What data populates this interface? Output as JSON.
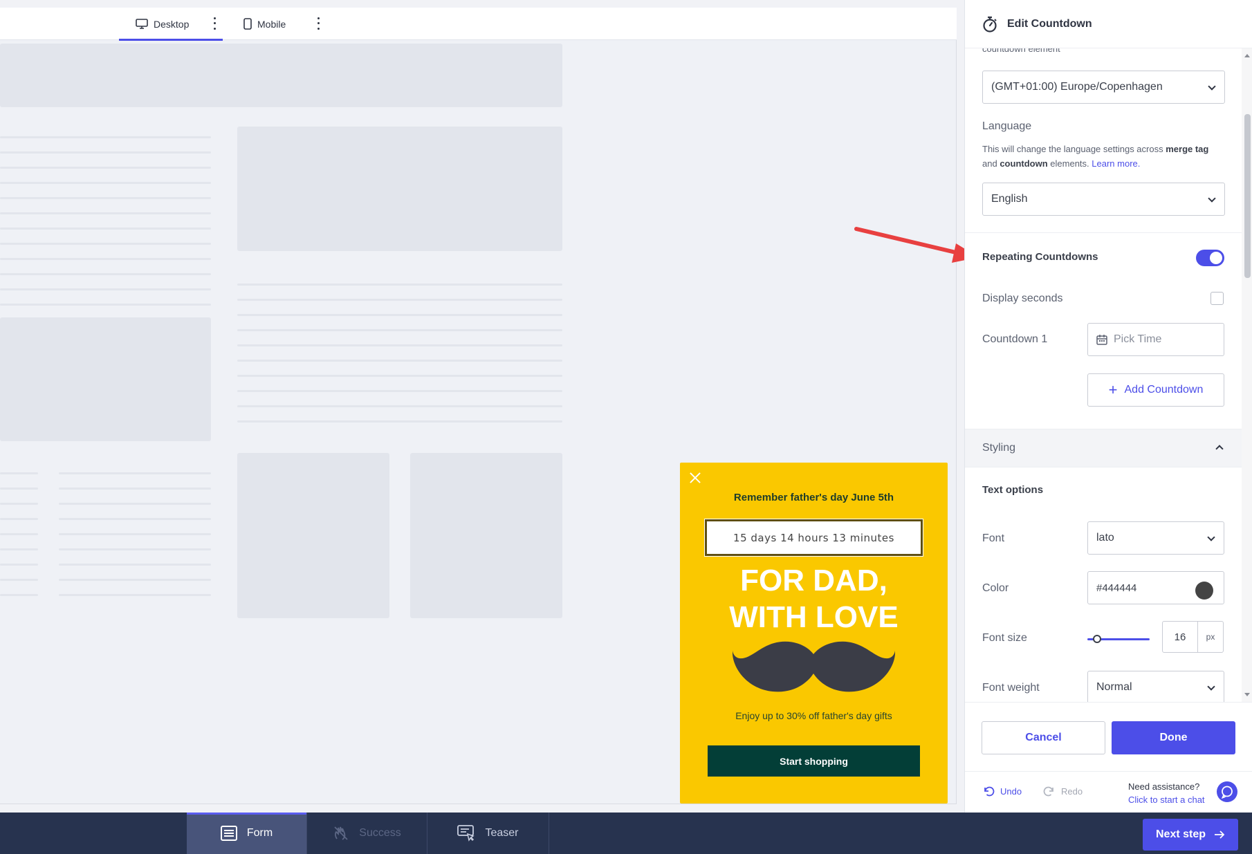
{
  "device_bar": {
    "desktop_label": "Desktop",
    "mobile_label": "Mobile"
  },
  "popup": {
    "heading": "Remember father's day June 5th",
    "countdown_text": "15 days 14 hours 13 minutes",
    "headline_line1": "FOR DAD,",
    "headline_line2": "WITH LOVE",
    "subtext": "Enjoy up to 30% off father's day gifts",
    "cta_label": "Start shopping",
    "colors": {
      "background": "#fac800",
      "cta": "#033e37",
      "mustache": "#3b3d47"
    }
  },
  "panel": {
    "title": "Edit Countdown",
    "cut_label": "countdown element",
    "timezone_value": "(GMT+01:00) Europe/Copenhagen",
    "language_label": "Language",
    "language_help_1": "This will change the language settings across",
    "language_help_b1": "merge tag",
    "language_help_2": "and",
    "language_help_b2": "countdown",
    "language_help_3": "elements.",
    "language_help_link": "Learn more.",
    "language_value": "English",
    "repeating_label": "Repeating Countdowns",
    "repeating_on": true,
    "display_seconds_label": "Display seconds",
    "display_seconds_checked": false,
    "countdown1_label": "Countdown 1",
    "pick_time_placeholder": "Pick Time",
    "add_countdown_label": "Add Countdown",
    "styling_label": "Styling",
    "text_options_label": "Text options",
    "font_label": "Font",
    "font_value": "lato",
    "color_label": "Color",
    "color_value": "#444444",
    "font_size_label": "Font size",
    "font_size_value": "16",
    "font_size_unit": "px",
    "font_size_slider_fraction": 0.1,
    "font_weight_label": "Font weight",
    "font_weight_value": "Normal",
    "cancel_label": "Cancel",
    "done_label": "Done",
    "undo_label": "Undo",
    "redo_label": "Redo",
    "assist_question": "Need assistance?",
    "assist_link": "Click to start a chat",
    "accent_color": "#4c4ee8"
  },
  "bottom_bar": {
    "steps": [
      {
        "label": "Form",
        "active": true,
        "disabled": false
      },
      {
        "label": "Success",
        "active": false,
        "disabled": true
      },
      {
        "label": "Teaser",
        "active": false,
        "disabled": false
      }
    ],
    "next_label": "Next step"
  }
}
